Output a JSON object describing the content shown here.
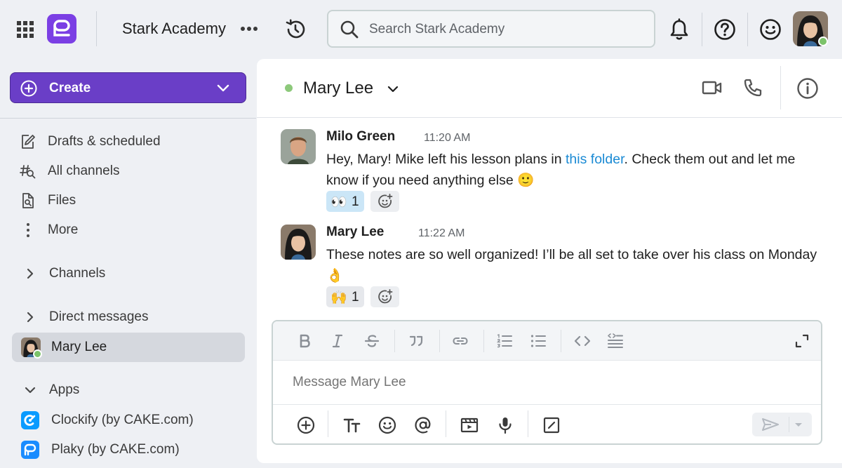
{
  "workspace": {
    "name": "Stark Academy"
  },
  "search": {
    "placeholder": "Search Stark Academy"
  },
  "sidebar": {
    "create_label": "Create",
    "nav": [
      {
        "label": "Drafts & scheduled",
        "icon": "edit-draft-icon"
      },
      {
        "label": "All channels",
        "icon": "channels-search-icon"
      },
      {
        "label": "Files",
        "icon": "files-search-icon"
      },
      {
        "label": "More",
        "icon": "more-vertical-icon"
      }
    ],
    "channels_label": "Channels",
    "direct_messages_label": "Direct messages",
    "active_dm": "Mary Lee",
    "apps_label": "Apps",
    "apps": [
      {
        "label": "Clockify (by CAKE.com)",
        "icon": "clockify-icon",
        "color": "#0a9bff"
      },
      {
        "label": "Plaky (by CAKE.com)",
        "icon": "plaky-icon",
        "color": "#1a8cff"
      }
    ]
  },
  "channel": {
    "name": "Mary Lee",
    "status_color": "#8dc97b"
  },
  "messages": [
    {
      "author": "Milo Green",
      "time": "11:20 AM",
      "text_before": "Hey, Mary! Mike left his lesson plans in ",
      "link": "this folder",
      "text_after": ". Check them out and let me know if you need anything else 🙂",
      "reaction_emoji": "👀",
      "reaction_count": "1"
    },
    {
      "author": "Mary Lee",
      "time": "11:22 AM",
      "text": "These notes are so well organized! I’ll be all set to take over his class on Monday 👌",
      "reaction_emoji": "🙌",
      "reaction_count": "1"
    }
  ],
  "composer": {
    "placeholder": "Message Mary Lee"
  },
  "colors": {
    "brand": "#6a3ec7",
    "link": "#1a8ad4",
    "online": "#7cc36a",
    "reaction_active": "#cbe6f7"
  }
}
